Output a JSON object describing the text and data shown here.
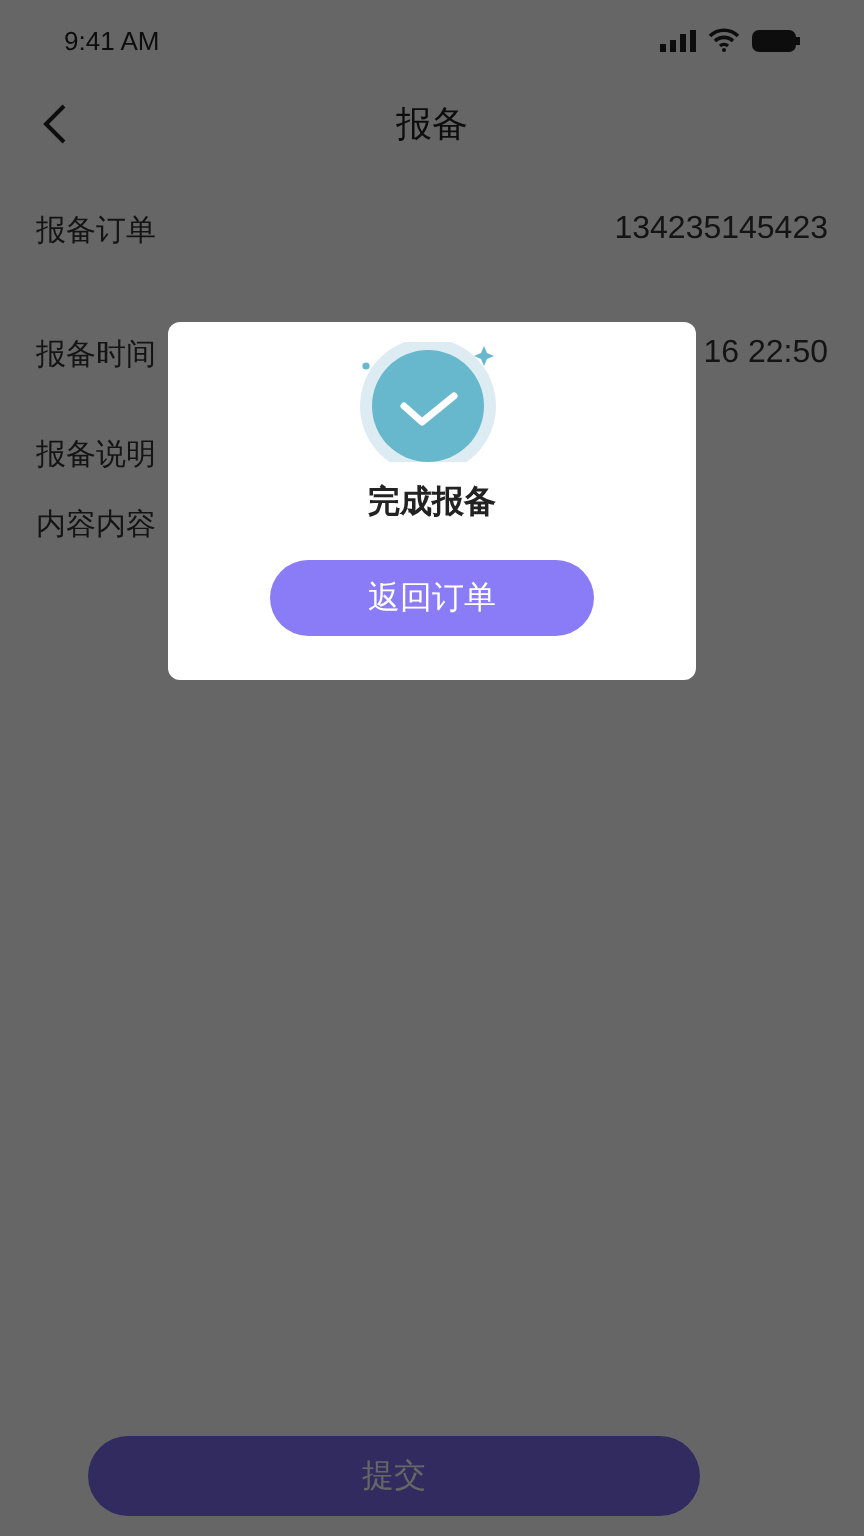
{
  "status_bar": {
    "time": "9:41 AM"
  },
  "nav": {
    "title": "报备"
  },
  "rows": [
    {
      "label": "报备订单",
      "value": "134235145423"
    },
    {
      "label": "报备时间",
      "value": "16  22:50"
    }
  ],
  "description": {
    "label": "报备说明",
    "text": "内容内容"
  },
  "submit_button": {
    "label": "提交"
  },
  "dialog": {
    "title": "完成报备",
    "button": "返回订单"
  }
}
